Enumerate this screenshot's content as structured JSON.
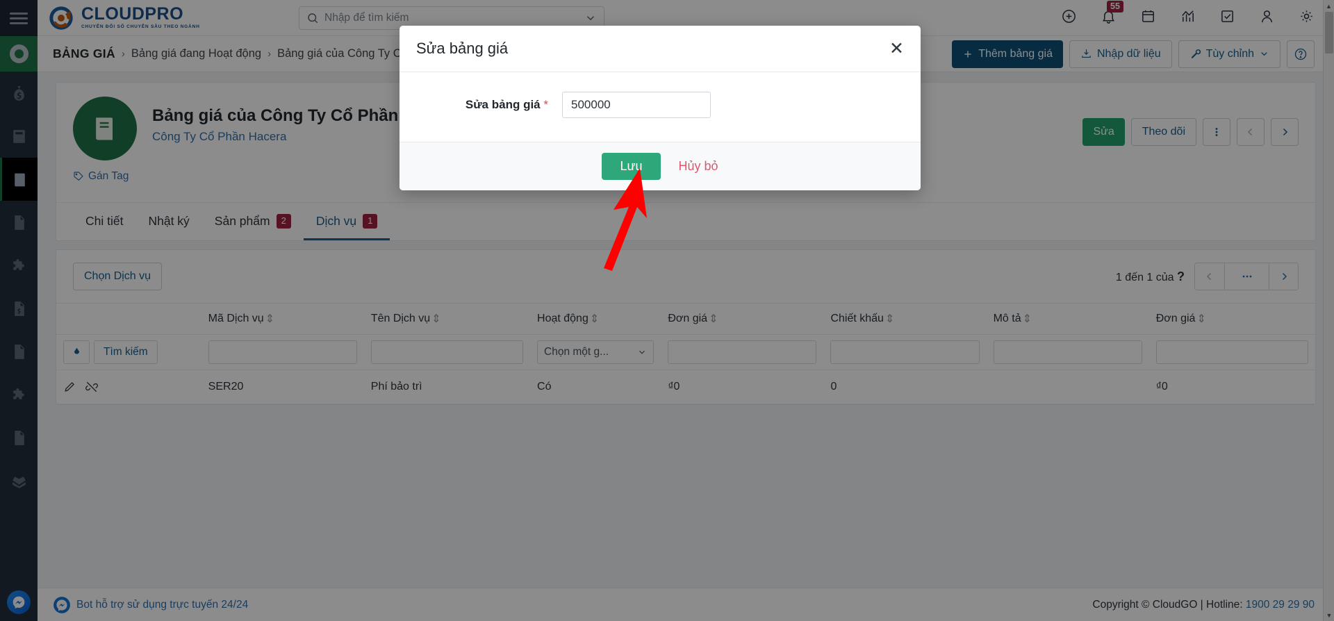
{
  "brand": {
    "name": "CLOUDPRO",
    "tagline": "CHUYỂN ĐỔI SỐ CHUYÊN SÂU THEO NGÀNH"
  },
  "search": {
    "placeholder": "Nhập để tìm kiếm",
    "value": "",
    "icon": "search-icon"
  },
  "topbar": {
    "icons": [
      {
        "name": "plus-circle-icon",
        "badge": ""
      },
      {
        "name": "bell-icon",
        "badge": "55"
      },
      {
        "name": "calendar-icon",
        "badge": ""
      },
      {
        "name": "analytics-icon",
        "badge": ""
      },
      {
        "name": "task-check-icon",
        "badge": ""
      },
      {
        "name": "user-icon",
        "badge": ""
      },
      {
        "name": "gear-icon",
        "badge": ""
      }
    ]
  },
  "sidebar": {
    "items": [
      {
        "name": "money-bag-icon",
        "active": false
      },
      {
        "name": "invoice-icon",
        "active": false
      },
      {
        "name": "price-book-icon",
        "active": true
      },
      {
        "name": "document-icon",
        "active": false
      },
      {
        "name": "puzzle-icon",
        "active": false
      },
      {
        "name": "price-doc-icon",
        "active": false
      },
      {
        "name": "download-doc-icon",
        "active": false
      },
      {
        "name": "puzzle-alt-icon",
        "active": false
      },
      {
        "name": "lines-doc-icon",
        "active": false
      },
      {
        "name": "open-box-icon",
        "active": false
      }
    ]
  },
  "breadcrumb": {
    "root": "BẢNG GIÁ",
    "separator": "›",
    "items": [
      "Bảng giá đang Hoạt động",
      "Bảng giá của Công Ty Cổ"
    ]
  },
  "crumb_actions": {
    "add_label": "Thêm bảng giá",
    "import_label": "Nhập dữ liệu",
    "customize_label": "Tùy chỉnh",
    "help_icon": "question-circle-icon"
  },
  "record": {
    "avatar_icon": "book-icon",
    "title": "Bảng giá của Công Ty Cổ Phần Hacera",
    "subtitle": "Công Ty Cổ Phần Hacera",
    "tag_label": "Gán Tag",
    "tag_icon": "tag-icon",
    "actions": {
      "edit_label": "Sửa",
      "follow_label": "Theo dõi",
      "more_icon": "vertical-dots-icon",
      "prev_icon": "chevron-left-icon",
      "next_icon": "chevron-right-icon"
    }
  },
  "tabs": [
    {
      "label": "Chi tiết",
      "badge": "",
      "active": false
    },
    {
      "label": "Nhật ký",
      "badge": "",
      "active": false
    },
    {
      "label": "Sản phẩm",
      "badge": "2",
      "active": false
    },
    {
      "label": "Dịch vụ",
      "badge": "1",
      "active": true
    }
  ],
  "panel": {
    "select_button": "Chọn Dịch vụ",
    "pager_text": "1 đến 1 của",
    "pager_total": "?",
    "pager_prev_icon": "chevron-left-icon",
    "pager_more_icon": "ellipsis-icon",
    "pager_next_icon": "chevron-right-icon"
  },
  "table": {
    "columns": [
      "",
      "Mã Dịch vụ",
      "Tên Dịch vụ",
      "Hoạt động",
      "Đơn giá",
      "Chiết khấu",
      "Mô tả",
      "Đơn giá"
    ],
    "filter": {
      "search_label": "Tìm kiếm",
      "search_icon": "filter-icon",
      "code_value": "",
      "name_value": "",
      "active_select": "Chọn một g...",
      "price_value": "",
      "discount_value": "",
      "desc_value": "",
      "price2_value": ""
    },
    "rows": [
      {
        "edit_icon": "pencil-icon",
        "unlink_icon": "unlink-icon",
        "code": "SER20",
        "name": "Phí bảo trì",
        "active": "Có",
        "price": "₫0",
        "discount": "0",
        "description": "",
        "price2": "₫0"
      }
    ]
  },
  "footer": {
    "bot_label": "Bot hỗ trợ sử dụng trực tuyến 24/24",
    "bot_icon": "messenger-icon",
    "copyright": "Copyright © CloudGO | Hotline: ",
    "hotline": "1900 29 29 90"
  },
  "modal": {
    "title": "Sửa bảng giá",
    "close_icon": "close-icon",
    "field_label": "Sửa bảng giá",
    "required_mark": "*",
    "field_value": "500000",
    "save_label": "Lưu",
    "cancel_label": "Hủy bỏ"
  },
  "colors": {
    "brand_blue": "#1b4f8a",
    "primary_blue": "#0d4f77",
    "green": "#20764a",
    "save_green": "#2ea87a",
    "badge_red": "#9e2440",
    "link_blue": "#2f6fae",
    "arrow_red": "#ff0000"
  }
}
